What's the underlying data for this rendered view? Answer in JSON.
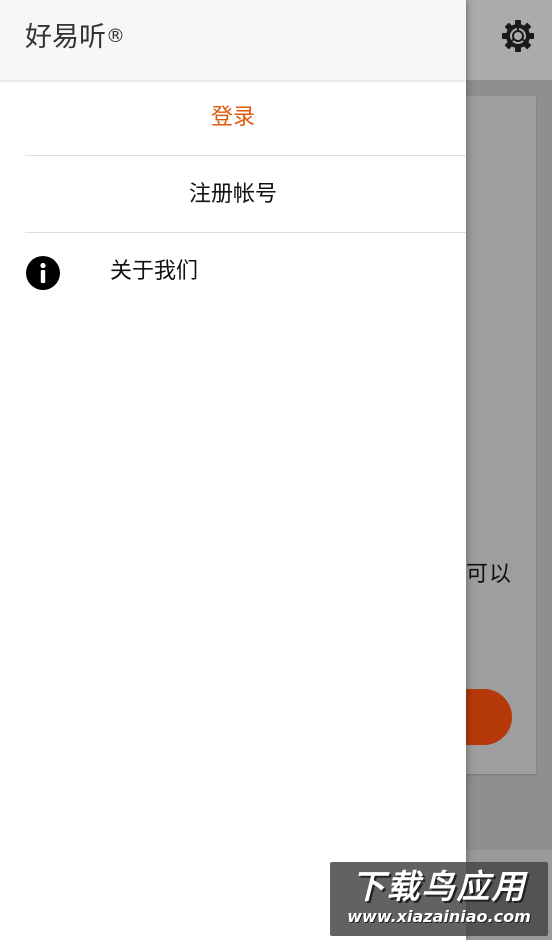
{
  "app": {
    "title": "好易听",
    "registered_mark": "®"
  },
  "drawer": {
    "items": [
      {
        "label": "登录",
        "color": "#e0590f"
      },
      {
        "label": "注册帐号"
      },
      {
        "label": "关于我们",
        "icon": "info-icon"
      }
    ]
  },
  "background": {
    "card_text": "可以",
    "button_color": "#b53808",
    "settings_icon": "gear-icon"
  },
  "watermark": {
    "title": "下载鸟应用",
    "url": "www.xiazainiao.com"
  },
  "colors": {
    "accent": "#e0590f",
    "scrim": "#8f8f8f"
  }
}
